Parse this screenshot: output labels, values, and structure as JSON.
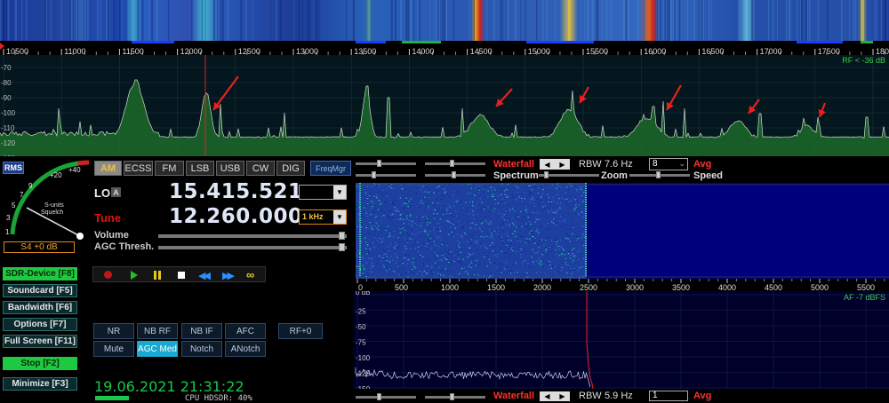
{
  "freq_axis": {
    "labels": [
      "10500",
      "11000",
      "11500",
      "12000",
      "12500",
      "13000",
      "13500",
      "14000",
      "14500",
      "15000",
      "15500",
      "16000",
      "16500",
      "17000",
      "17500",
      "18000"
    ]
  },
  "spectrum": {
    "db_labels": [
      "-70",
      "-80",
      "-90",
      "-100",
      "-110",
      "-120",
      "-130"
    ],
    "rf_label": "RF < -36 dB"
  },
  "smeter": {
    "rms": "RMS",
    "scale": [
      "1",
      "3",
      "5",
      "7",
      "9",
      "+20",
      "+40"
    ],
    "caption": "S-units\nSquelch",
    "value": "S4 +0 dB"
  },
  "left_buttons": [
    {
      "label": "SDR-Device [F8]",
      "active": true
    },
    {
      "label": "Soundcard [F5]",
      "active": false
    },
    {
      "label": "Bandwidth [F6]",
      "active": false
    },
    {
      "label": "Options [F7]",
      "active": false
    },
    {
      "label": "Full Screen [F11]",
      "active": false
    },
    {
      "label": "Stop [F2]",
      "active": true
    },
    {
      "label": "Minimize [F3]",
      "active": false
    }
  ],
  "modes": [
    "AM",
    "ECSS",
    "FM",
    "LSB",
    "USB",
    "CW",
    "DIG"
  ],
  "freqmgr": "FreqMgr",
  "lo": {
    "label": "LO",
    "badge": "A",
    "value": "15.415.521"
  },
  "tune": {
    "label": "Tune",
    "value": "12.260.000",
    "step": "1 kHz"
  },
  "sliders": {
    "volume": "Volume",
    "agc": "AGC Thresh."
  },
  "dsp_buttons": [
    "NR",
    "NB RF",
    "NB IF",
    "AFC",
    "RF+0",
    "Mute",
    "AGC Med",
    "Notch",
    "ANotch"
  ],
  "datetime": "19.06.2021 21:31:22",
  "cpu": "CPU HDSDR: 40%",
  "controls_top": {
    "waterfall": "Waterfall",
    "rbw": "RBW",
    "rbw_value": "7.6 Hz",
    "avg_value": "8",
    "avg": "Avg",
    "spectrum": "Spectrum",
    "zoom": "Zoom",
    "speed": "Speed"
  },
  "af_axis": {
    "labels": [
      "0",
      "500",
      "1000",
      "1500",
      "2000",
      "2500",
      "3000",
      "3500",
      "4000",
      "4500",
      "5000",
      "5500"
    ]
  },
  "af_spec": {
    "db_labels": [
      "0 dB",
      "-25",
      "-50",
      "-75",
      "-100",
      "-125",
      "-150"
    ],
    "af_label": "AF -7 dBFS"
  },
  "controls_bottom": {
    "waterfall": "Waterfall",
    "rbw": "RBW",
    "rbw_value": "5.9 Hz",
    "avg_value": "1",
    "avg": "Avg"
  },
  "colors": {
    "accent_green": "#19c94a",
    "tune_red": "#e01010",
    "waterfall_red": "#ff3030",
    "digits": "#dfe6f6"
  }
}
